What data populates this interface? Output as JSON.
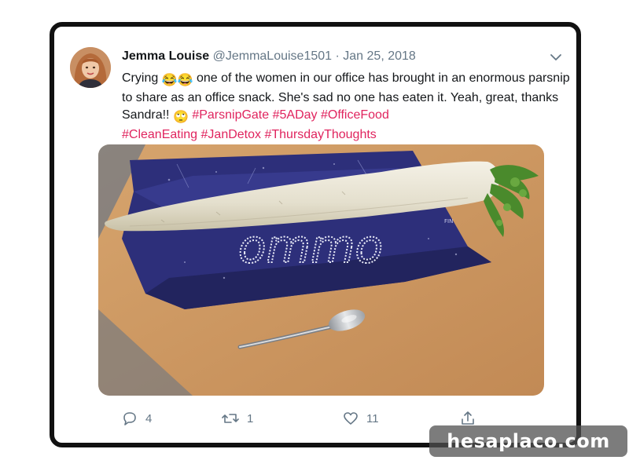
{
  "tweet": {
    "author_name": "Jemma Louise",
    "author_handle": "@JemmaLouise1501",
    "separator": "·",
    "date": "Jan 25, 2018",
    "text_lines": {
      "part1": "Crying ",
      "emoji1": "😂😂",
      "part2": " one of the women in our office has brought in an enormous parsnip to share as an office snack. She's sad no one has eaten it. Yeah, great, thanks Sandra!! ",
      "emoji2": "🙄",
      "part3": " "
    },
    "hashtags": [
      "#ParsnipGate",
      "#5ADay",
      "#OfficeFood",
      "#CleanEating",
      "#JanDetox",
      "#ThursdayThoughts"
    ],
    "photo": {
      "bag_text": "ommo",
      "bag_corner_text": "FIN"
    },
    "actions": {
      "reply_count": "4",
      "retweet_count": "1",
      "like_count": "11"
    },
    "icons": {
      "reply": "reply-icon",
      "retweet": "retweet-icon",
      "like": "heart-icon",
      "share": "share-icon",
      "menu": "chevron-down-icon"
    }
  },
  "watermark": {
    "text": "hesaplaco.com"
  },
  "colors": {
    "hashtag": "#e0245e",
    "muted": "#657786",
    "text": "#14171a",
    "border": "#111111"
  }
}
